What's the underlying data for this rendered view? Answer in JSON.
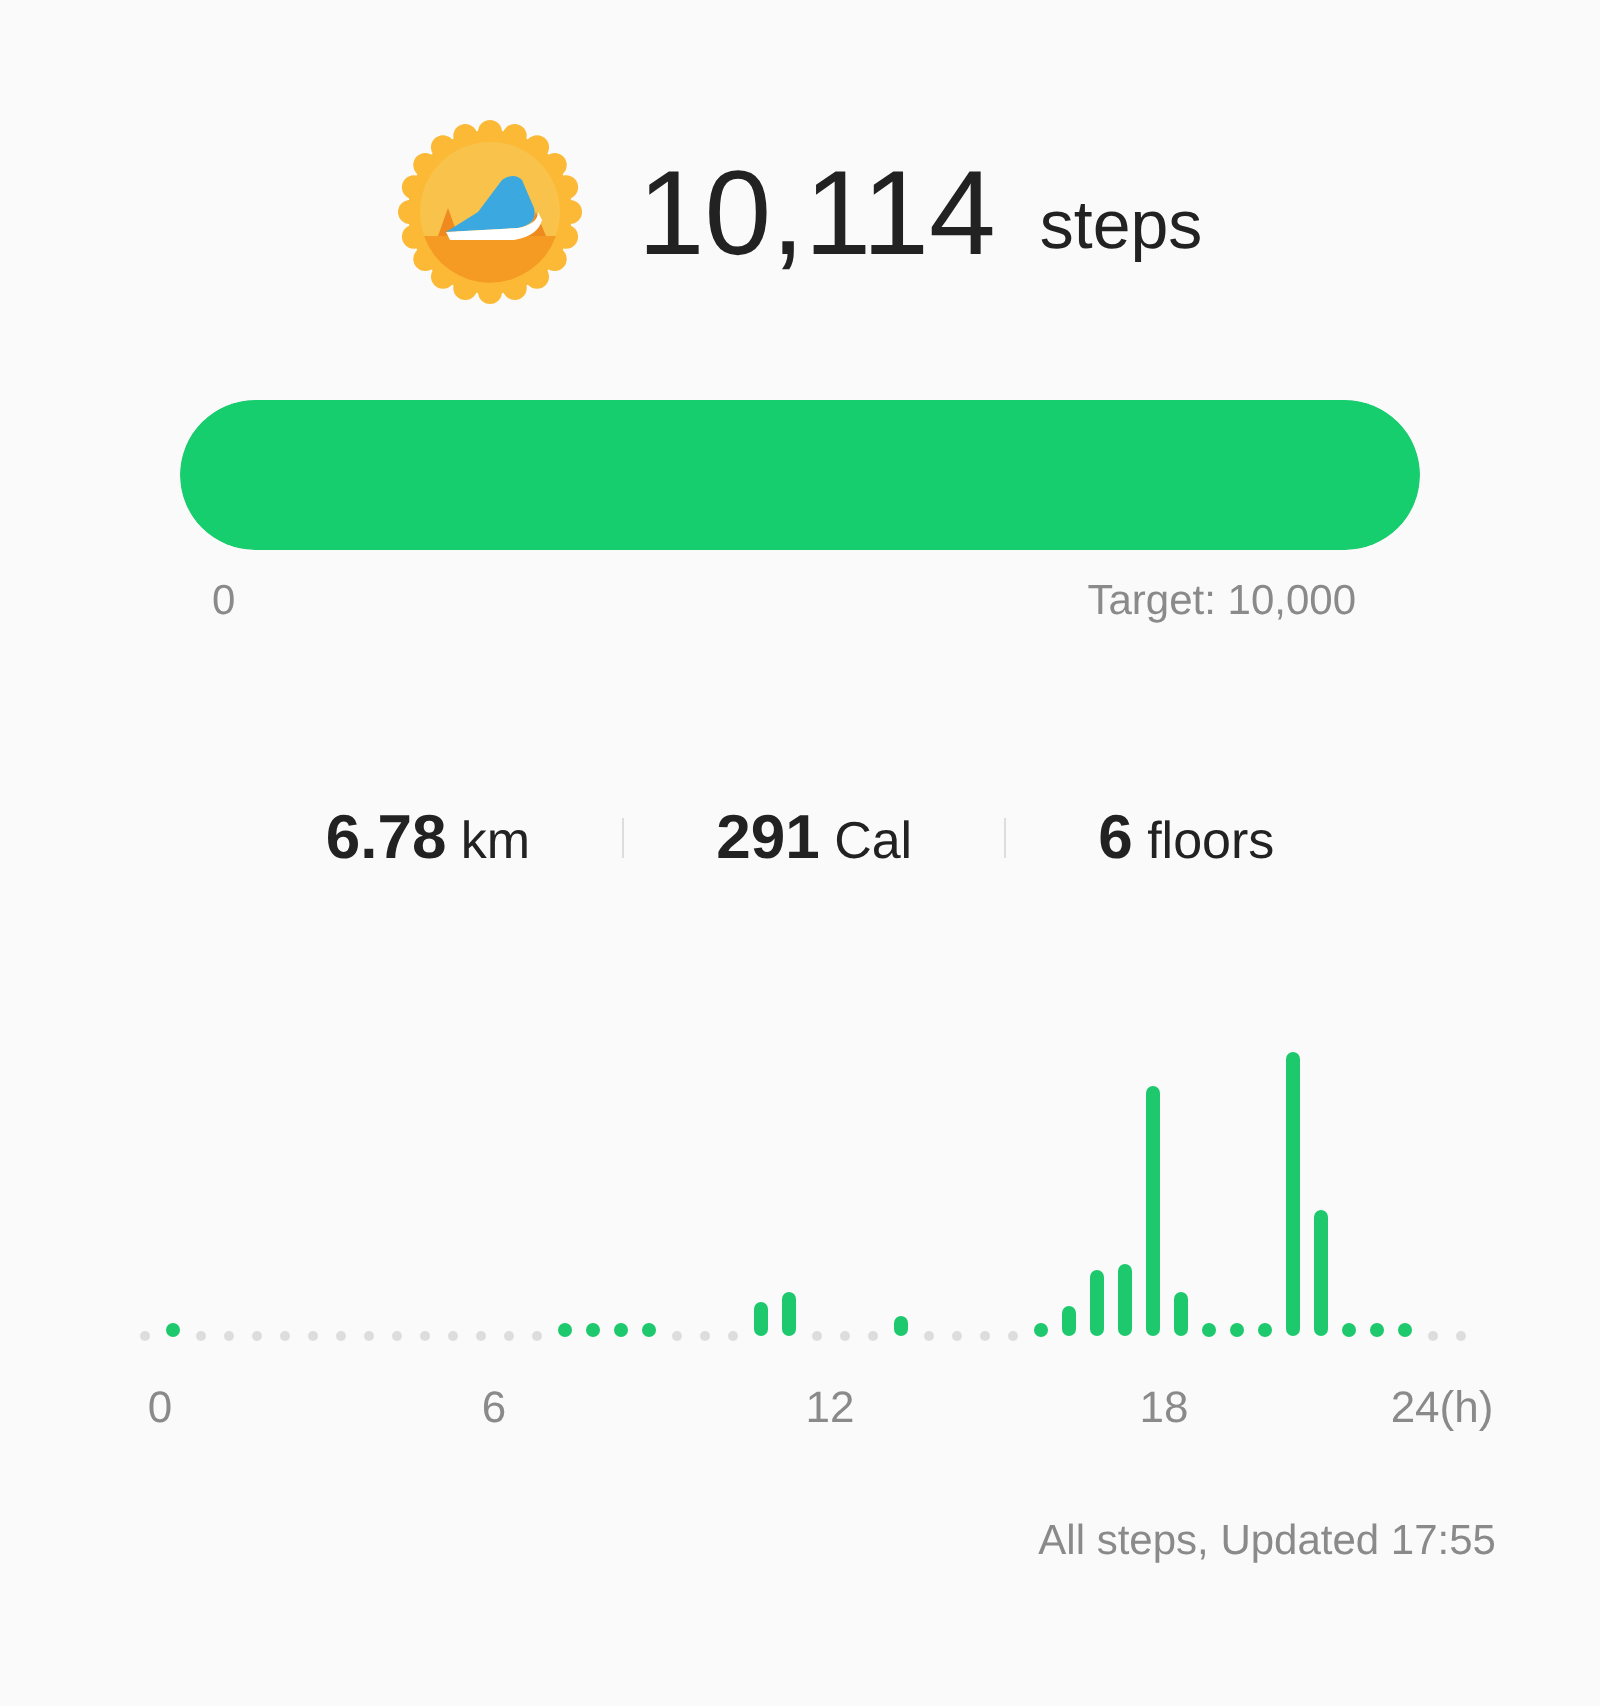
{
  "summary": {
    "steps": "10,114",
    "unit": "steps"
  },
  "progress": {
    "level": 1,
    "start_label": "0",
    "target_label": "Target: 10,000"
  },
  "stats": [
    {
      "value": "6.78",
      "unit": "km"
    },
    {
      "value": "291",
      "unit": "Cal"
    },
    {
      "value": "6",
      "unit": "floors"
    }
  ],
  "chart": {
    "x_labels": [
      "0",
      "6",
      "12",
      "18",
      "24(h)"
    ]
  },
  "footer": "All steps, Updated 17:55"
}
